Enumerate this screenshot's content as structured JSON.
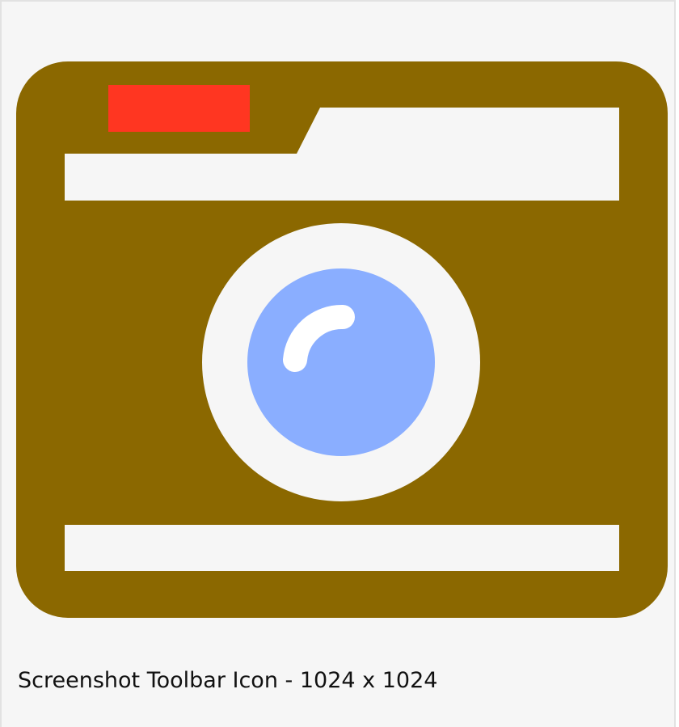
{
  "icon": {
    "name": "camera-icon",
    "body_color": "#8b6800",
    "flash_color": "#ff3621",
    "cutout_color": "#f6f6f6",
    "lens_color": "#8aaeff",
    "highlight_color": "#ffffff"
  },
  "caption": {
    "text": "Screenshot Toolbar Icon - 1024 x 1024"
  }
}
